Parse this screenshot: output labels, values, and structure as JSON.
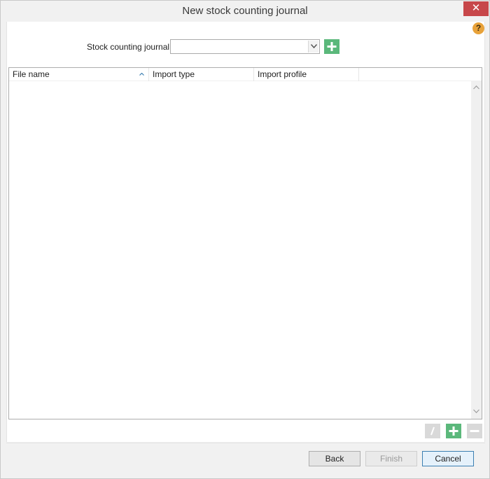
{
  "window": {
    "title": "New stock counting journal",
    "close_glyph": "✕"
  },
  "help": {
    "glyph": "?",
    "icon": "help-icon"
  },
  "journal": {
    "label": "Stock counting journal:",
    "value": "",
    "add_icon": "plus-icon"
  },
  "grid": {
    "columns": [
      "File name",
      "Import type",
      "Import profile"
    ],
    "sorted_column": "File name",
    "sort_direction": "ascending",
    "rows": []
  },
  "grid_actions": {
    "edit_icon": "edit-icon",
    "add_icon": "plus-icon",
    "remove_icon": "minus-icon"
  },
  "footer": {
    "back_label": "Back",
    "finish_label": "Finish",
    "cancel_label": "Cancel"
  },
  "colors": {
    "accent_green": "#5bb87b",
    "close_red": "#c7474a",
    "help_orange": "#e8a23a",
    "default_button_border": "#3c7fb1"
  }
}
